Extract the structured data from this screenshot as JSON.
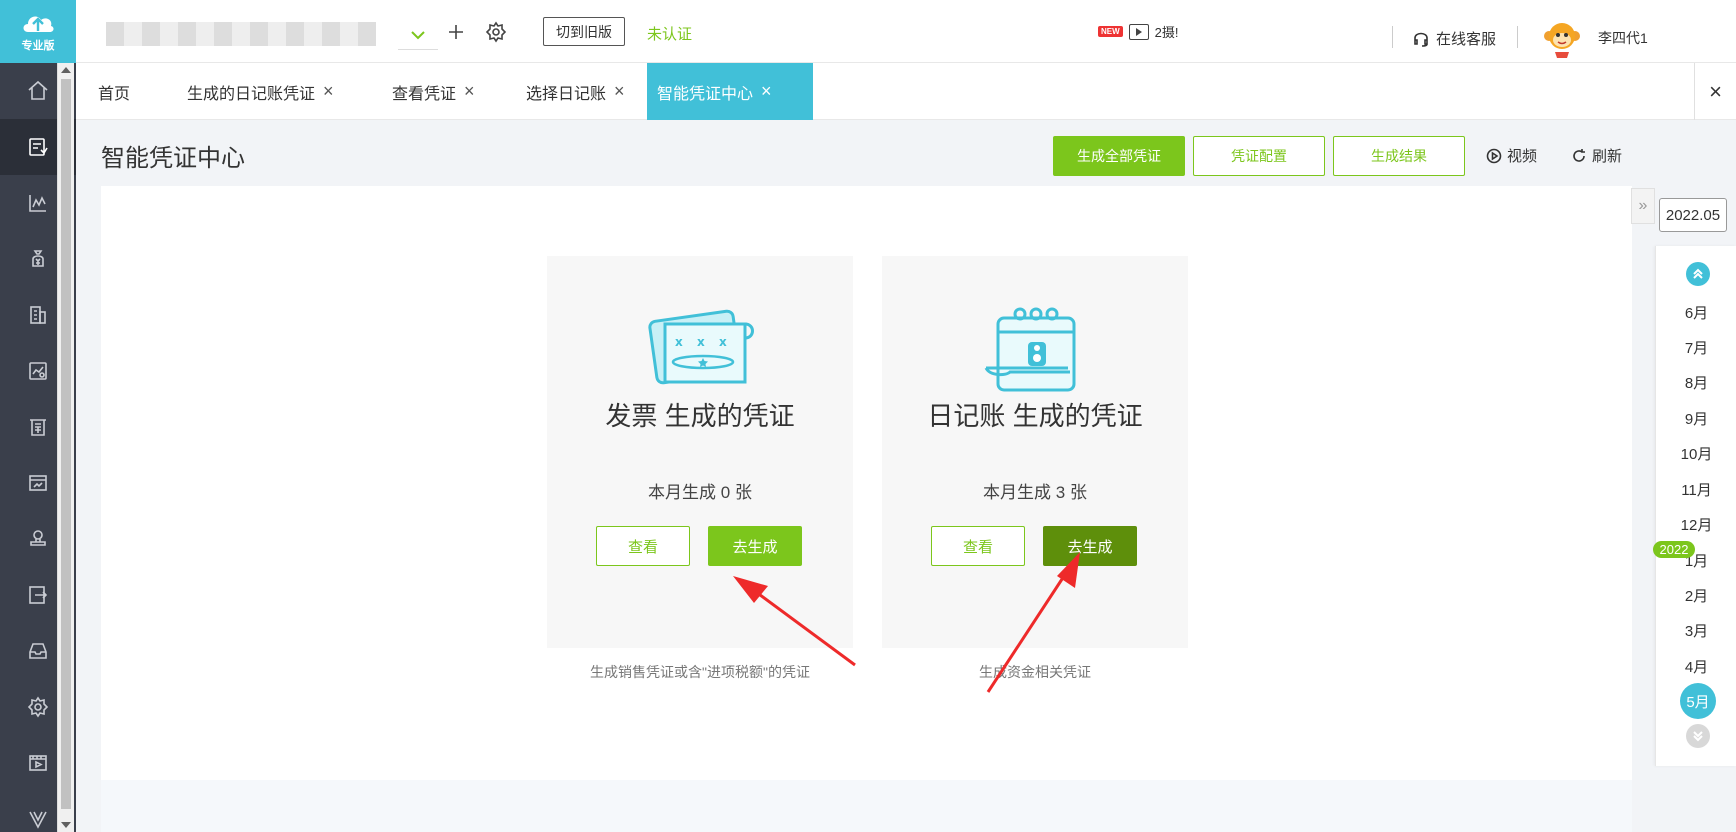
{
  "sidebar": {
    "logo_text": "专业版",
    "icons": [
      "home-icon",
      "voucher-icon",
      "chart-icon",
      "money-bag-icon",
      "building-icon",
      "report-icon",
      "invoice-icon",
      "dashboard-icon",
      "stamp-icon",
      "export-icon",
      "inbox-icon",
      "settings-icon",
      "video-icon",
      "vip-icon"
    ]
  },
  "header": {
    "switch_old_label": "切到旧版",
    "unverified_label": "未认证",
    "promo_badge": "NEW",
    "promo_text": "2摄!",
    "support_label": "在线客服",
    "username": "李四代1"
  },
  "tabs": [
    {
      "label": "首页",
      "closable": false
    },
    {
      "label": "生成的日记账凭证",
      "closable": true
    },
    {
      "label": "查看凭证",
      "closable": true
    },
    {
      "label": "选择日记账",
      "closable": true
    },
    {
      "label": "智能凭证中心",
      "closable": true,
      "active": true
    }
  ],
  "tab_close_symbol": "×",
  "page": {
    "title": "智能凭证中心",
    "generate_all_label": "生成全部凭证",
    "config_label": "凭证配置",
    "result_label": "生成结果",
    "video_label": "视频",
    "refresh_label": "刷新"
  },
  "cards": [
    {
      "title": "发票 生成的凭证",
      "count_text": "本月生成 0 张",
      "view_label": "查看",
      "generate_label": "去生成",
      "description": "生成销售凭证或含\"进项税额\"的凭证"
    },
    {
      "title": "日记账 生成的凭证",
      "count_text": "本月生成 3 张",
      "view_label": "查看",
      "generate_label": "去生成",
      "description": "生成资金相关凭证"
    }
  ],
  "period": {
    "current": "2022.05",
    "months": [
      "6月",
      "7月",
      "8月",
      "9月",
      "10月",
      "11月",
      "12月",
      "1月",
      "2月",
      "3月",
      "4月",
      "5月"
    ],
    "year_tag": "2022",
    "selected_month": "5月"
  },
  "colors": {
    "accent": "#41c0d8",
    "green": "#7cc61c",
    "dark_green": "#5e8f0b",
    "sidebar": "#3a3f4b",
    "arrow": "#ee2a2a"
  }
}
